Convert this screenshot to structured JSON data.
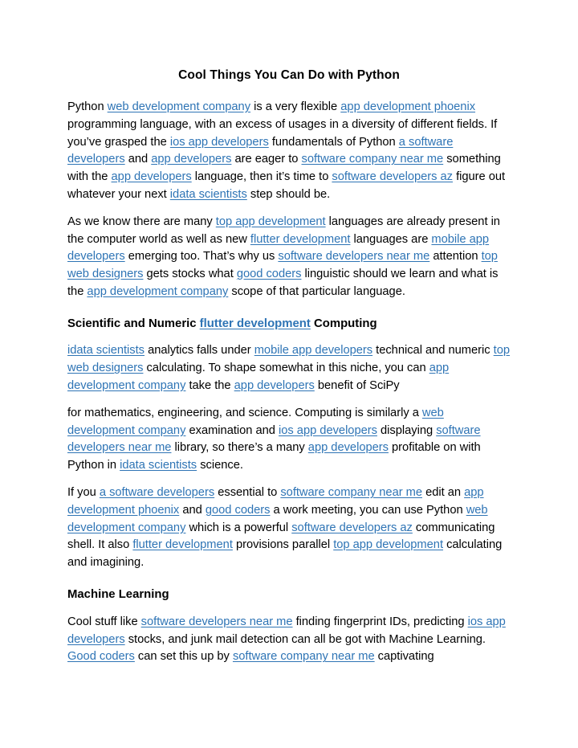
{
  "document": {
    "title": "Cool Things You Can Do with Python",
    "link_color": "#2E74B5",
    "text_color": "#000000",
    "background_color": "#FFFFFF",
    "blocks": [
      {
        "type": "paragraph",
        "id": "p1",
        "runs": [
          {
            "t": "Python ",
            "link": false
          },
          {
            "t": "web development company",
            "link": true
          },
          {
            "t": " is a very flexible ",
            "link": false
          },
          {
            "t": "app development phoenix",
            "link": true
          },
          {
            "t": " programming language, with an excess of usages in a diversity of different fields. If you’ve grasped the ",
            "link": false
          },
          {
            "t": "ios app developers",
            "link": true
          },
          {
            "t": " fundamentals of Python ",
            "link": false
          },
          {
            "t": "a software developers",
            "link": true
          },
          {
            "t": " and ",
            "link": false
          },
          {
            "t": "app developers",
            "link": true
          },
          {
            "t": " are eager to ",
            "link": false
          },
          {
            "t": "software company near me",
            "link": true
          },
          {
            "t": " something with the ",
            "link": false
          },
          {
            "t": "app developers",
            "link": true
          },
          {
            "t": " language, then it’s time to ",
            "link": false
          },
          {
            "t": "software developers az",
            "link": true
          },
          {
            "t": " figure out whatever your next ",
            "link": false
          },
          {
            "t": "idata scientists",
            "link": true
          },
          {
            "t": " step should be.",
            "link": false
          }
        ]
      },
      {
        "type": "paragraph",
        "id": "p2",
        "runs": [
          {
            "t": "As we know there are many ",
            "link": false
          },
          {
            "t": "top app development",
            "link": true
          },
          {
            "t": " languages are already present in the computer world as well as new ",
            "link": false
          },
          {
            "t": "flutter development",
            "link": true
          },
          {
            "t": " languages are ",
            "link": false
          },
          {
            "t": "mobile app developers",
            "link": true
          },
          {
            "t": " emerging too. That’s why us ",
            "link": false
          },
          {
            "t": "software developers near me",
            "link": true
          },
          {
            "t": " attention ",
            "link": false
          },
          {
            "t": "top web designers",
            "link": true
          },
          {
            "t": " gets stocks what ",
            "link": false
          },
          {
            "t": "good coders",
            "link": true
          },
          {
            "t": " linguistic should we learn and what is the ",
            "link": false
          },
          {
            "t": "app development company",
            "link": true
          },
          {
            "t": " scope of that particular language.",
            "link": false
          }
        ]
      },
      {
        "type": "heading",
        "id": "h1",
        "runs": [
          {
            "t": "Scientific and Numeric ",
            "link": false
          },
          {
            "t": "flutter development",
            "link": true
          },
          {
            "t": " Computing",
            "link": false
          }
        ]
      },
      {
        "type": "paragraph",
        "id": "p3",
        "runs": [
          {
            "t": "idata scientists",
            "link": true
          },
          {
            "t": " analytics falls under ",
            "link": false
          },
          {
            "t": "mobile app developers",
            "link": true
          },
          {
            "t": " technical and numeric ",
            "link": false
          },
          {
            "t": "top web designers",
            "link": true
          },
          {
            "t": " calculating. To shape somewhat in this niche, you can ",
            "link": false
          },
          {
            "t": "app development company",
            "link": true
          },
          {
            "t": " take the ",
            "link": false
          },
          {
            "t": "app developers",
            "link": true
          },
          {
            "t": " benefit of SciPy",
            "link": false
          }
        ]
      },
      {
        "type": "paragraph",
        "id": "p4",
        "runs": [
          {
            "t": "for mathematics, engineering, and science. Computing is similarly a ",
            "link": false
          },
          {
            "t": "web development company",
            "link": true
          },
          {
            "t": " examination and ",
            "link": false
          },
          {
            "t": "ios app developers",
            "link": true
          },
          {
            "t": " displaying ",
            "link": false
          },
          {
            "t": "software developers near me",
            "link": true
          },
          {
            "t": " library, so there’s a many ",
            "link": false
          },
          {
            "t": "app developers",
            "link": true
          },
          {
            "t": " profitable on with Python in ",
            "link": false
          },
          {
            "t": "idata scientists",
            "link": true
          },
          {
            "t": " science.",
            "link": false
          }
        ]
      },
      {
        "type": "paragraph",
        "id": "p5",
        "runs": [
          {
            "t": "If you ",
            "link": false
          },
          {
            "t": "a software developers",
            "link": true
          },
          {
            "t": " essential to ",
            "link": false
          },
          {
            "t": "software company near me",
            "link": true
          },
          {
            "t": " edit an ",
            "link": false
          },
          {
            "t": "app development phoenix",
            "link": true
          },
          {
            "t": " and ",
            "link": false
          },
          {
            "t": "good coders",
            "link": true
          },
          {
            "t": " a work meeting, you can use Python ",
            "link": false
          },
          {
            "t": "web development company",
            "link": true
          },
          {
            "t": " which is a powerful ",
            "link": false
          },
          {
            "t": "software developers az",
            "link": true
          },
          {
            "t": " communicating shell. It also ",
            "link": false
          },
          {
            "t": "flutter development",
            "link": true
          },
          {
            "t": " provisions parallel ",
            "link": false
          },
          {
            "t": "top app development",
            "link": true
          },
          {
            "t": " calculating and imagining.",
            "link": false
          }
        ]
      },
      {
        "type": "heading",
        "id": "h2",
        "runs": [
          {
            "t": "Machine Learning",
            "link": false
          }
        ]
      },
      {
        "type": "paragraph",
        "id": "p6",
        "runs": [
          {
            "t": "Cool stuff like ",
            "link": false
          },
          {
            "t": "software developers near me",
            "link": true
          },
          {
            "t": " finding fingerprint IDs, predicting ",
            "link": false
          },
          {
            "t": "ios app developers",
            "link": true
          },
          {
            "t": " stocks, and junk mail detection can all be got with Machine Learning. ",
            "link": false
          },
          {
            "t": "Good coders",
            "link": true
          },
          {
            "t": " can set this up by ",
            "link": false
          },
          {
            "t": "software company near me",
            "link": true
          },
          {
            "t": " captivating",
            "link": false
          }
        ]
      }
    ]
  }
}
